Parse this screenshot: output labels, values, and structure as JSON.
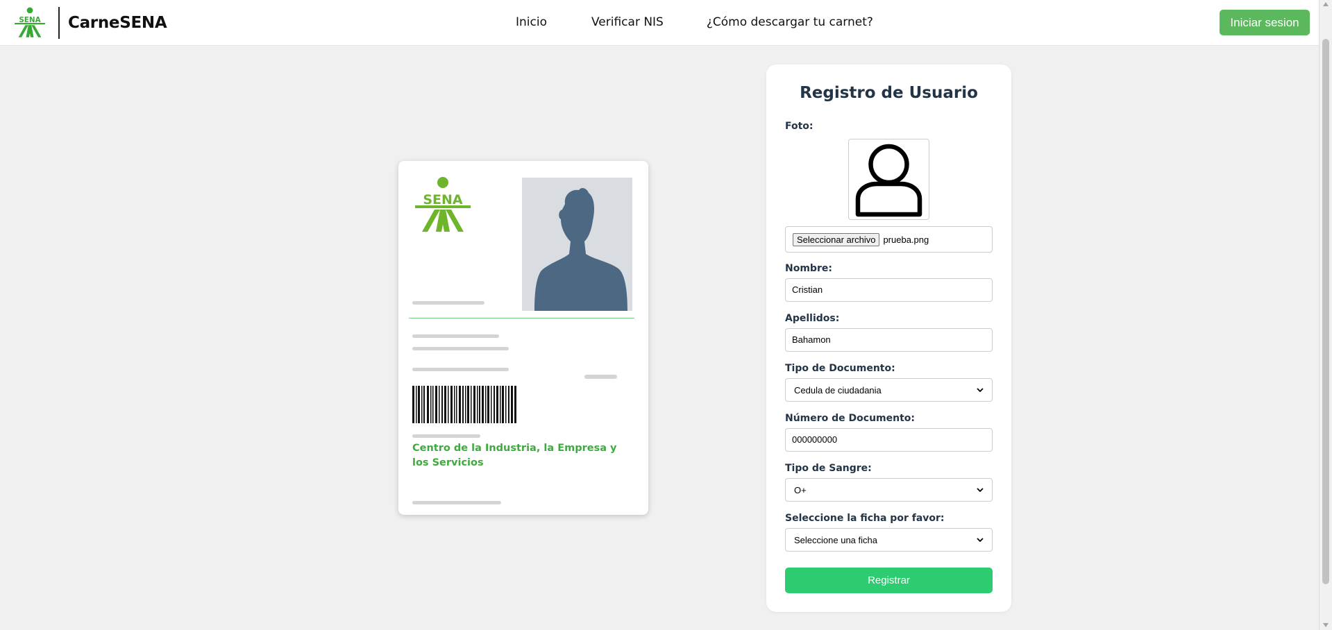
{
  "header": {
    "brand_name": "CarneSENA",
    "nav": [
      "Inicio",
      "Verificar NIS",
      "¿Cómo descargar tu carnet?"
    ],
    "login_label": "Iniciar sesion"
  },
  "logo_text": "SENA",
  "card": {
    "center_name": "Centro de la Industria, la Empresa y los Servicios"
  },
  "form": {
    "title": "Registro de Usuario",
    "photo_label": "Foto:",
    "file_button": "Seleccionar archivo",
    "file_name": "prueba.png",
    "nombre_label": "Nombre:",
    "nombre_value": "Cristian",
    "apellidos_label": "Apellidos:",
    "apellidos_value": "Bahamon",
    "tipo_doc_label": "Tipo de Documento:",
    "tipo_doc_value": "Cedula de ciudadania",
    "num_doc_label": "Número de Documento:",
    "num_doc_value": "000000000",
    "sangre_label": "Tipo de Sangre:",
    "sangre_value": "O+",
    "ficha_label": "Seleccione la ficha por favor:",
    "ficha_value": "Seleccione una ficha",
    "submit_label": "Registrar"
  },
  "colors": {
    "sena_green": "#39a935",
    "login_green": "#5cb85c",
    "submit_green": "#2ecc71",
    "silhouette": "#4d6882"
  },
  "icons": [
    "sena-logo-icon",
    "avatar-icon",
    "person-silhouette-icon",
    "barcode-icon",
    "chevron-down-icon"
  ]
}
